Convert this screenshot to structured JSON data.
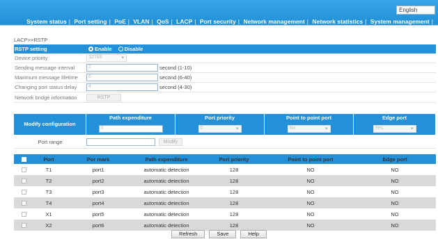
{
  "header": {
    "language": "English",
    "nav": [
      "System status",
      "Port setting",
      "PoE",
      "VLAN",
      "QoS",
      "LACP",
      "Port security",
      "Network management",
      "Network statistics",
      "System management"
    ]
  },
  "breadcrumb": "LACP>>RSTP",
  "rstp": {
    "setting_label": "RSTP setting",
    "enable_label": "Enable",
    "disable_label": "Disable",
    "device_priority_label": "Device priority",
    "device_priority_value": "32768",
    "sending_interval_label": "Sending message interval",
    "sending_interval_value": "2",
    "sending_interval_hint": "second (1-10)",
    "max_lifetime_label": "Maximum message lifetime",
    "max_lifetime_value": "6",
    "max_lifetime_hint": "second (6-40)",
    "changing_delay_label": "Changing port status delay",
    "changing_delay_value": "4",
    "changing_delay_hint": "second (4-30)",
    "bridge_info_label": "Network bridge information",
    "bridge_info_button": "RSTP"
  },
  "modify": {
    "title": "Modify configuration",
    "col_path": "Path expenditure",
    "col_priority": "Port priority",
    "col_p2p": "Point to point port",
    "col_edge": "Edge port",
    "path_value": "0",
    "priority_value": "0",
    "p2p_value": "No",
    "edge_value": "Yes",
    "range_label": "Port range",
    "modify_button": "Modify"
  },
  "table": {
    "headers": [
      "",
      "Port",
      "Por mark",
      "Path expenditure",
      "Port priority",
      "Point to point port",
      "Edge port"
    ],
    "rows": [
      {
        "port": "T1",
        "mark": "port1",
        "path": "automatic detection",
        "priority": "128",
        "p2p": "NO",
        "edge": "NO"
      },
      {
        "port": "T2",
        "mark": "port2",
        "path": "automatic detection",
        "priority": "128",
        "p2p": "NO",
        "edge": "NO"
      },
      {
        "port": "T3",
        "mark": "port3",
        "path": "automatic detection",
        "priority": "128",
        "p2p": "NO",
        "edge": "NO"
      },
      {
        "port": "T4",
        "mark": "port4",
        "path": "automatic detection",
        "priority": "128",
        "p2p": "NO",
        "edge": "NO"
      },
      {
        "port": "X1",
        "mark": "port5",
        "path": "automatic detection",
        "priority": "128",
        "p2p": "NO",
        "edge": "NO"
      },
      {
        "port": "X2",
        "mark": "port6",
        "path": "automatic detection",
        "priority": "128",
        "p2p": "NO",
        "edge": "NO"
      }
    ]
  },
  "footer": {
    "refresh": "Refresh",
    "save": "Save",
    "help": "Help"
  },
  "colors": {
    "accent": "#2390d8",
    "row_alt": "#d9d9d9"
  }
}
